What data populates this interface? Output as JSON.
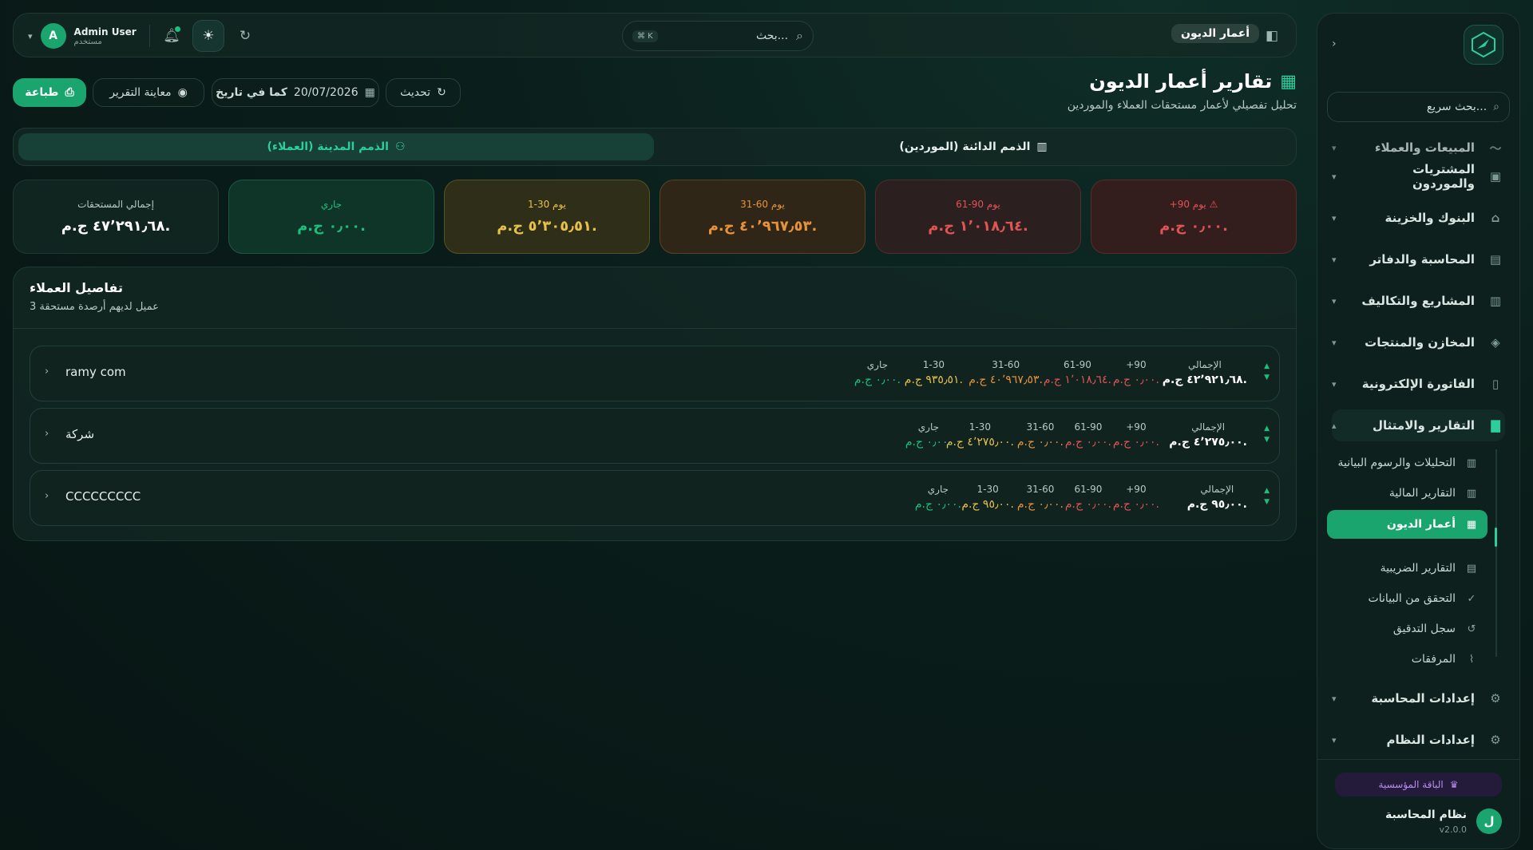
{
  "colors": {
    "accent": "#1aa56f",
    "red": "#e05454",
    "orange": "#e8923a",
    "yellow": "#e8c14a",
    "green": "#1dbf7d"
  },
  "topbar": {
    "user_name": "Admin User",
    "user_role": "مستخدم",
    "avatar_letter": "A",
    "search_placeholder": "بحث...",
    "search_shortcut": "⌘ K",
    "page_chip": "أعمار الديون"
  },
  "page": {
    "title": "تقارير أعمار الديون",
    "subtitle": "تحليل تفصيلي لأعمار مستحقات العملاء والموردين"
  },
  "actions": {
    "print": "طباعة",
    "preview": "معاينة التقرير",
    "date": "20/07/2026",
    "as_of": "كما في تاريخ",
    "refresh": "تحديث"
  },
  "tabs": {
    "receivables": "الذمم المدينة (العملاء)",
    "payables": "الذمم الدائنة (الموردين)"
  },
  "kpis": {
    "total": {
      "title": "إجمالي المستحقات",
      "value": "٤٧٬٢٩١٫٦٨ ج.م."
    },
    "current": {
      "title": "جاري",
      "value": "٠٫٠٠ ج.م."
    },
    "d1_30": {
      "title": "1-30 يوم",
      "value": "٥٬٣٠٥٫٥١ ج.م."
    },
    "d31_60": {
      "title": "31-60 يوم",
      "value": "٤٠٬٩٦٧٫٥٣ ج.م."
    },
    "d61_90": {
      "title": "61-90 يوم",
      "value": "١٬٠١٨٫٦٤ ج.م."
    },
    "d90p": {
      "title": "+90 يوم",
      "value": "٠٫٠٠ ج.م."
    }
  },
  "details": {
    "title": "تفاصيل العملاء",
    "subtitle": "3 عميل لديهم أرصدة مستحقة",
    "headers": {
      "total": "الإجمالي",
      "d90": "+90",
      "d61": "61-90",
      "d31": "31-60",
      "d1": "1-30",
      "cur": "جاري"
    },
    "rows": [
      {
        "name": "ramy com",
        "total": "٤٢٬٩٢١٫٦٨ ج.م.",
        "d90": "٠٫٠٠ ج.م.",
        "d61": "١٬٠١٨٫٦٤ ج.م.",
        "d31": "٤٠٬٩٦٧٫٥٣ ج.م.",
        "d1": "٩٣٥٫٥١ ج.م.",
        "cur": "٠٫٠٠ ج.م."
      },
      {
        "name": "شركة",
        "total": "٤٬٢٧٥٫٠٠ ج.م.",
        "d90": "٠٫٠٠ ج.م.",
        "d61": "٠٫٠٠ ج.م.",
        "d31": "٠٫٠٠ ج.م.",
        "d1": "٤٬٢٧٥٫٠٠ ج.م.",
        "cur": "٠٫٠٠ ج.م."
      },
      {
        "name": "CCCCCCCCC",
        "total": "٩٥٫٠٠ ج.م.",
        "d90": "٠٫٠٠ ج.م.",
        "d61": "٠٫٠٠ ج.م.",
        "d31": "٠٫٠٠ ج.م.",
        "d1": "٩٥٫٠٠ ج.م.",
        "cur": "٠٫٠٠ ج.م."
      }
    ]
  },
  "sidebar": {
    "search_placeholder": "بحث سريع...",
    "items": [
      "المبيعات والعملاء",
      "المشتريات والموردون",
      "البنوك والخزينة",
      "المحاسبة والدفاتر",
      "المشاريع والتكاليف",
      "المخازن والمنتجات",
      "الفاتورة الإلكترونية",
      "التقارير والامتثال"
    ],
    "sub": [
      "التحليلات والرسوم البيانية",
      "التقارير المالية",
      "أعمار الديون",
      "التقارير الضريبية",
      "التحقق من البيانات",
      "سجل التدقيق",
      "المرفقات"
    ],
    "bottom_items": [
      "إعدادات المحاسبة",
      "إعدادات النظام"
    ],
    "plan": "الباقة المؤسسية",
    "app_name": "نظام المحاسبة",
    "version": "v2.0.0",
    "logo_letter": "ل"
  }
}
